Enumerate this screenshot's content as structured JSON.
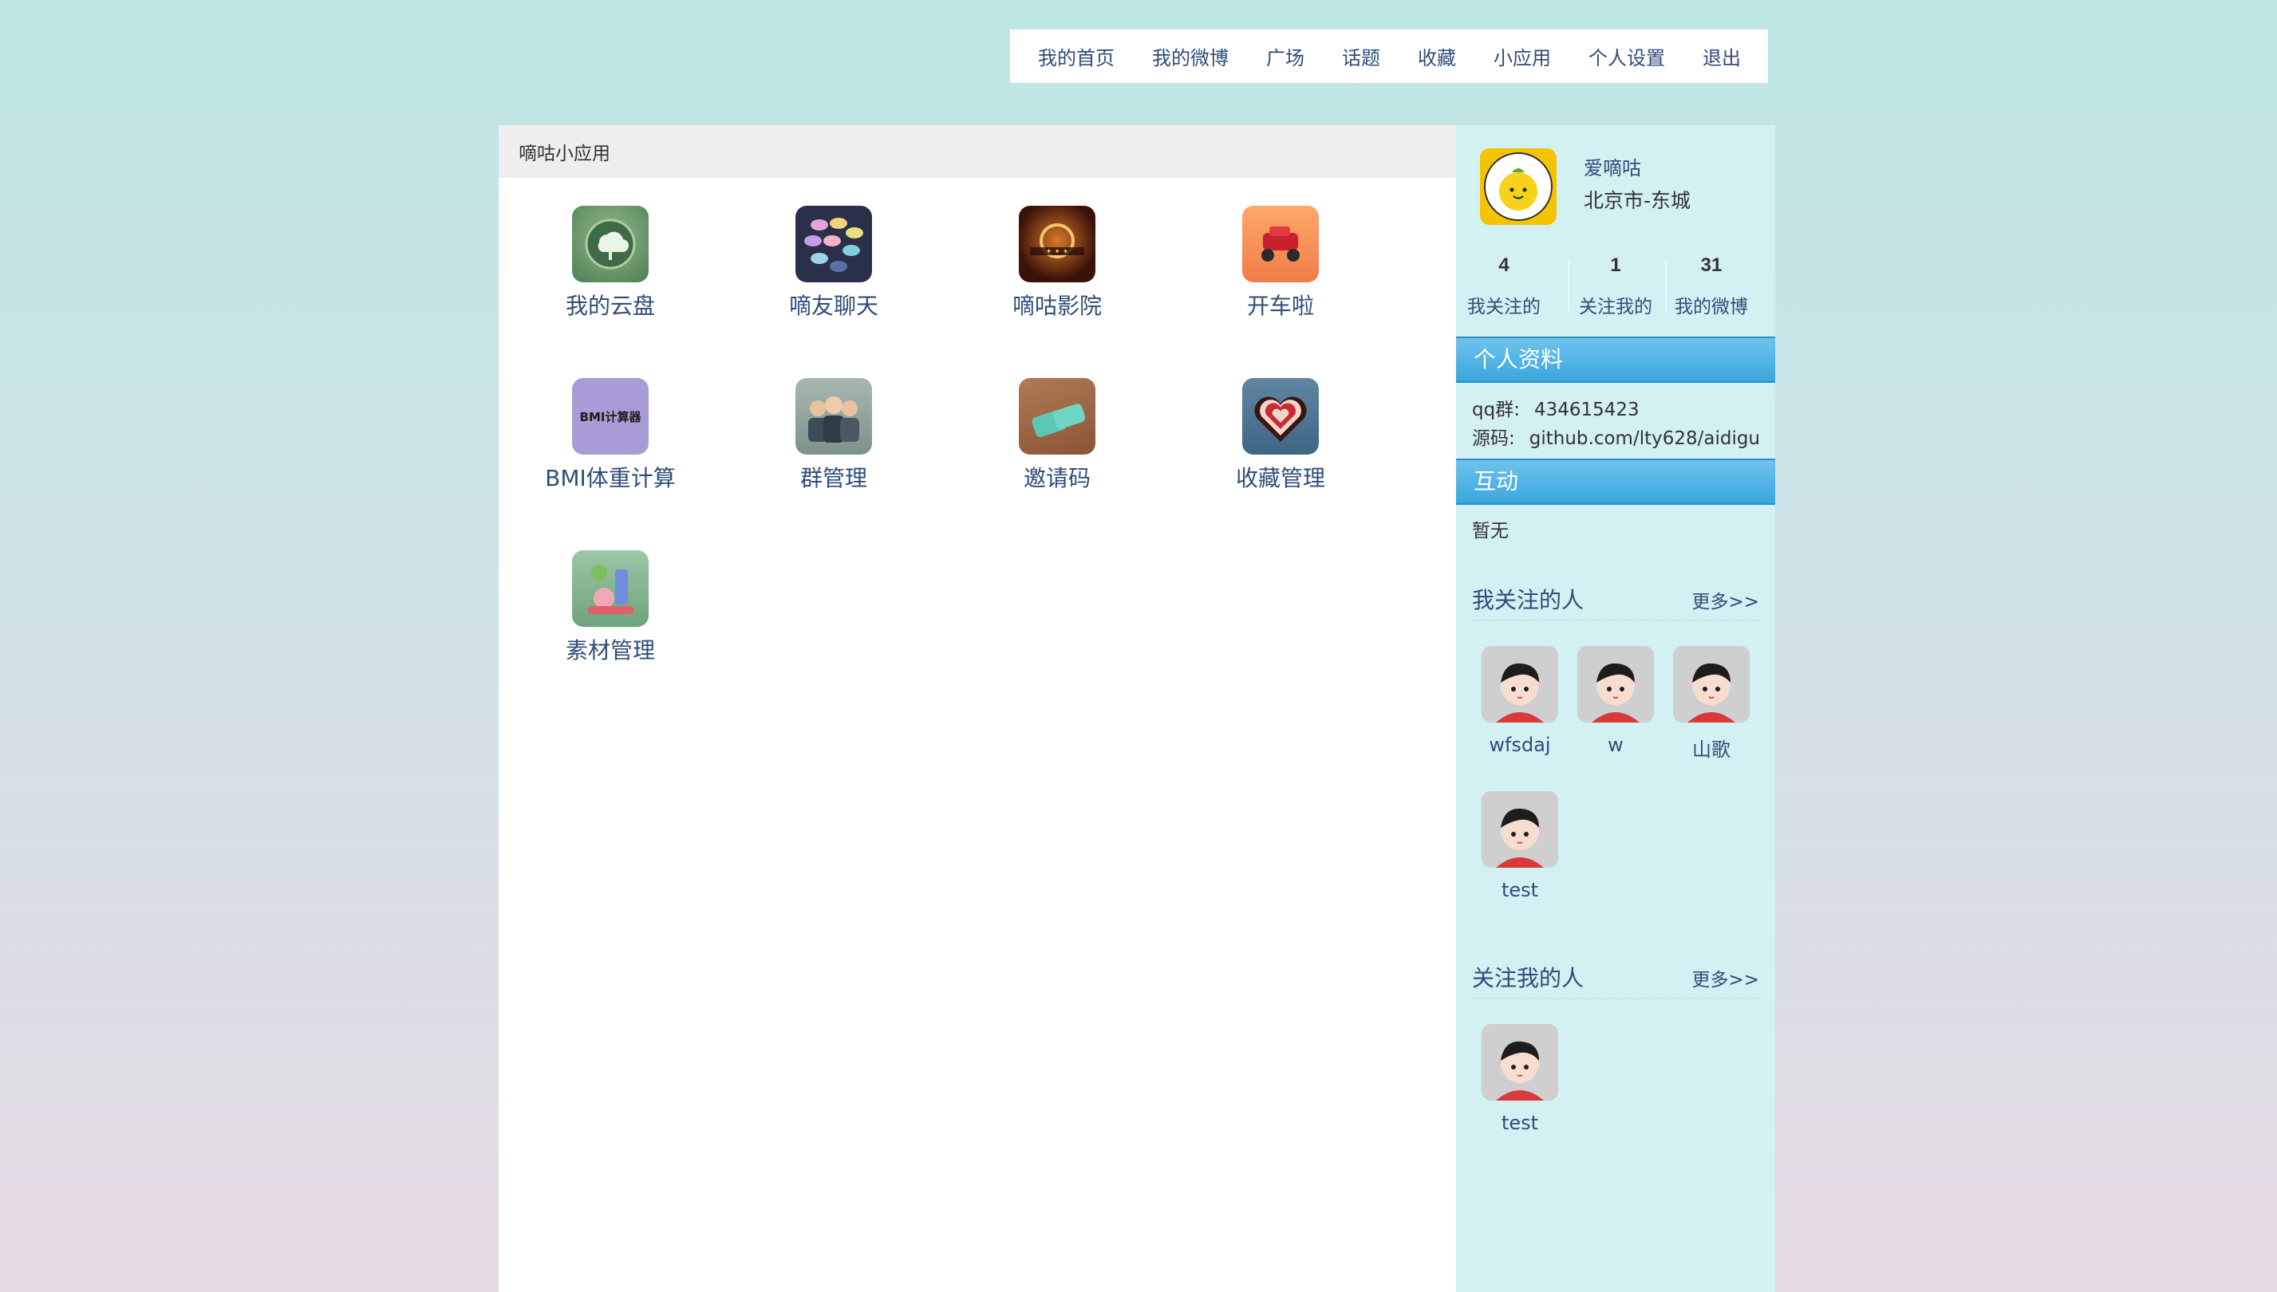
{
  "nav": [
    "我的首页",
    "我的微博",
    "广场",
    "话题",
    "收藏",
    "小应用",
    "个人设置",
    "退出"
  ],
  "main": {
    "title": "嘀咕小应用"
  },
  "apps": [
    {
      "label": "我的云盘",
      "icon": "cloud-drive-icon"
    },
    {
      "label": "嘀友聊天",
      "icon": "chat-bubbles-icon"
    },
    {
      "label": "嘀咕影院",
      "icon": "cinema-icon"
    },
    {
      "label": "开车啦",
      "icon": "car-icon"
    },
    {
      "label": "BMI体重计算",
      "icon": "bmi-calculator-icon",
      "icon_text": "BMI计算器"
    },
    {
      "label": "群管理",
      "icon": "group-people-icon"
    },
    {
      "label": "邀请码",
      "icon": "invite-code-icon"
    },
    {
      "label": "收藏管理",
      "icon": "heart-icon"
    },
    {
      "label": "素材管理",
      "icon": "materials-icon"
    }
  ],
  "profile": {
    "name": "爱嘀咕",
    "location": "北京市-东城",
    "stats": [
      {
        "num": "4",
        "label": "我关注的"
      },
      {
        "num": "1",
        "label": "关注我的"
      },
      {
        "num": "31",
        "label": "我的微博"
      }
    ]
  },
  "personal_info": {
    "title": "个人资料",
    "qq_label": "qq群:",
    "qq_value": "434615423",
    "src_label": "源码:",
    "src_value": "github.com/lty628/aidigu"
  },
  "interaction": {
    "title": "互动",
    "text": "暂无"
  },
  "following": {
    "title": "我关注的人",
    "more": "更多>>",
    "people": [
      "wfsdaj",
      "w",
      "山歌",
      "test"
    ]
  },
  "followers": {
    "title": "关注我的人",
    "more": "更多>>",
    "people": [
      "test"
    ]
  },
  "colors": {
    "link": "#2f4d7a",
    "section_bar": "#3aa6de",
    "sidebar_bg": "#d3f0f3"
  }
}
